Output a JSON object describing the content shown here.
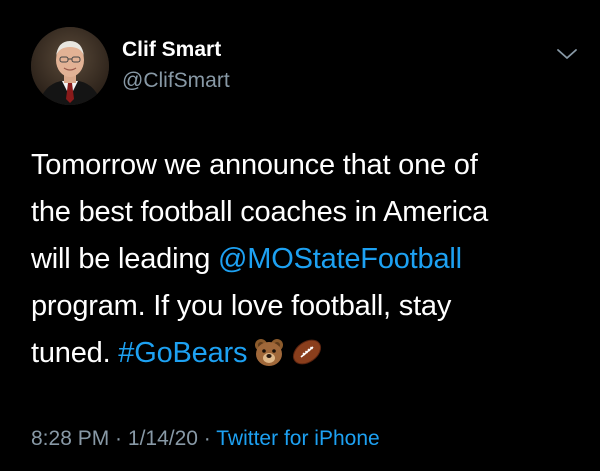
{
  "author": {
    "name": "Clif Smart",
    "handle": "@ClifSmart"
  },
  "tweet": {
    "line1": "Tomorrow we announce that one of",
    "line2": "the best football coaches in America",
    "line3_pre": "will be leading ",
    "mention": "@MOStateFootball",
    "line4": "program. If you love football, stay",
    "line5_pre": "tuned. ",
    "hashtag": "#GoBears",
    "emojis": [
      "bear-emoji",
      "football-emoji"
    ]
  },
  "meta": {
    "time": "8:28 PM",
    "sep1": " · ",
    "date": "1/14/20",
    "sep2": " · ",
    "source": "Twitter for iPhone"
  },
  "colors": {
    "background": "#000000",
    "text": "#ffffff",
    "secondary": "#8899a6",
    "link": "#1da1f2"
  },
  "icons": {
    "more": "chevron-down-icon"
  }
}
